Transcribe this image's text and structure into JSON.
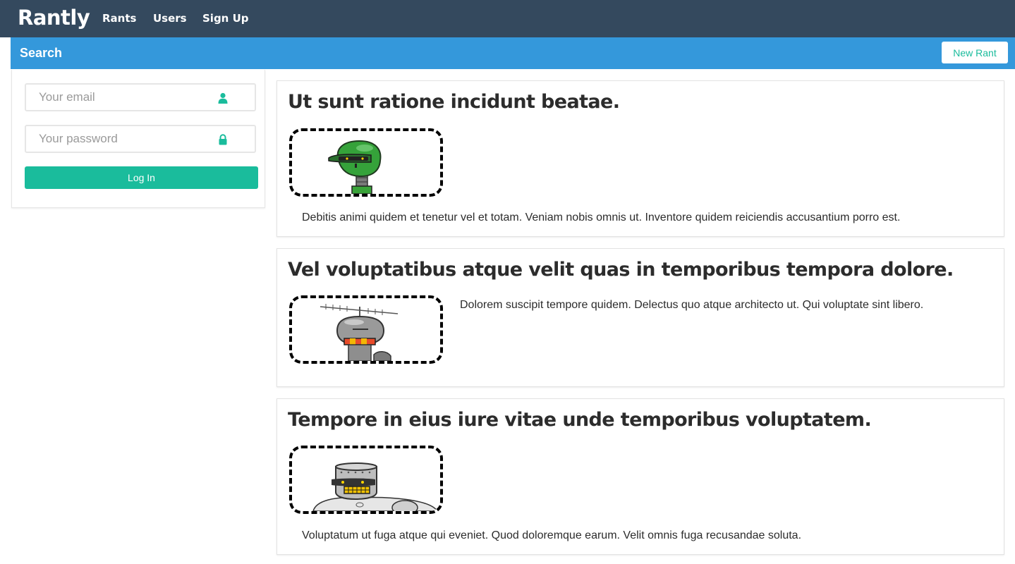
{
  "navbar": {
    "brand": "Rantly",
    "links": [
      "Rants",
      "Users",
      "Sign Up"
    ]
  },
  "subbar": {
    "title": "Search",
    "new_rant_label": "New Rant"
  },
  "login": {
    "email_placeholder": "Your email",
    "password_placeholder": "Your password",
    "button_label": "Log In"
  },
  "rants": [
    {
      "title": "Ut sunt ratione incidunt beatae.",
      "body": "Debitis animi quidem et tenetur vel et totam. Veniam nobis omnis ut. Inventore quidem reiciendis accusantium porro est.",
      "avatar_icon": "green-robot-icon"
    },
    {
      "title": "Vel voluptatibus atque velit quas in temporibus tempora dolore.",
      "body": "Dolorem suscipit tempore quidem. Delectus quo atque architecto ut. Qui voluptate sint libero.",
      "avatar_icon": "antenna-robot-icon"
    },
    {
      "title": "Tempore in eius iure vitae unde temporibus voluptatem.",
      "body": "Voluptatum ut fuga atque qui eveniet. Quod doloremque earum. Velit omnis fuga recusandae soluta.",
      "avatar_icon": "bucket-robot-icon"
    }
  ],
  "colors": {
    "navbar": "#34495e",
    "subbar": "#3498db",
    "accent": "#1abc9c"
  }
}
